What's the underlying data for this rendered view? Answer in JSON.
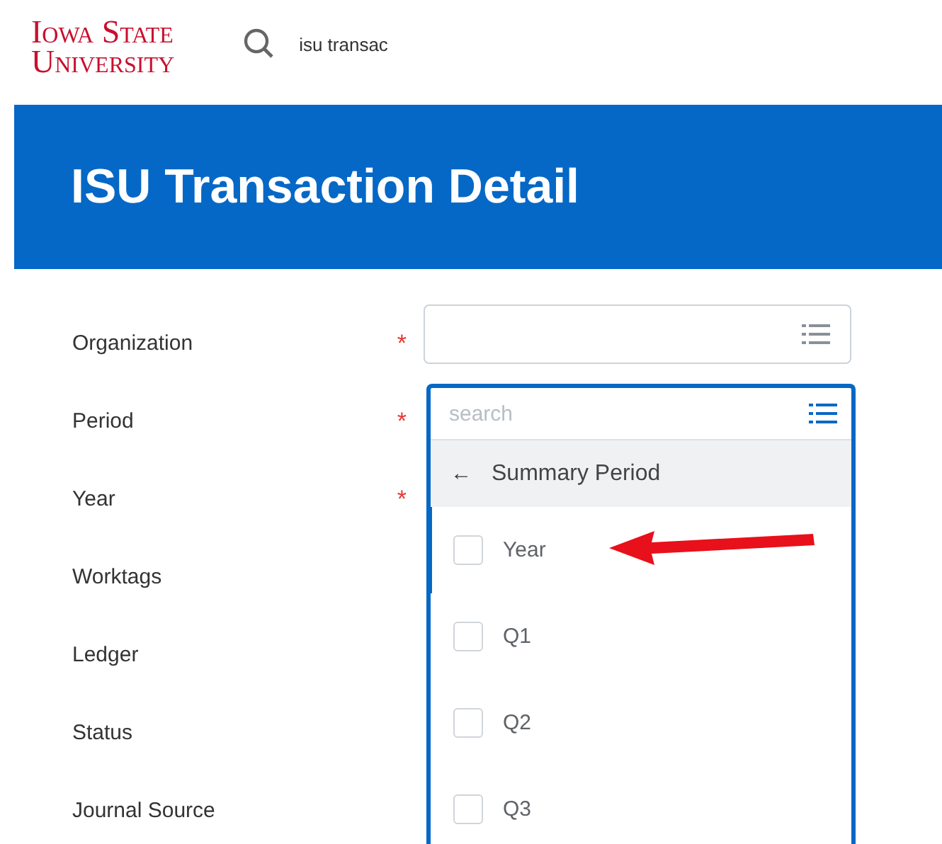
{
  "header": {
    "logo_line_1": "Iowa State",
    "logo_line_2": "University",
    "search": {
      "value": "isu transac"
    }
  },
  "banner": {
    "title": "ISU Transaction Detail"
  },
  "form": {
    "required_mark": "*",
    "fields": [
      {
        "label": "Organization",
        "required": true
      },
      {
        "label": "Period",
        "required": true
      },
      {
        "label": "Year",
        "required": true
      },
      {
        "label": "Worktags",
        "required": false
      },
      {
        "label": "Ledger",
        "required": false
      },
      {
        "label": "Status",
        "required": false
      },
      {
        "label": "Journal Source",
        "required": false
      }
    ]
  },
  "organization_field": {
    "focused": false
  },
  "period_dropdown": {
    "placeholder": "search",
    "category": "Summary Period",
    "back_glyph": "←",
    "options": [
      {
        "label": "Year",
        "selected": true,
        "checked": false
      },
      {
        "label": "Q1",
        "selected": false,
        "checked": false
      },
      {
        "label": "Q2",
        "selected": false,
        "checked": false
      },
      {
        "label": "Q3",
        "selected": false,
        "checked": false
      }
    ]
  }
}
